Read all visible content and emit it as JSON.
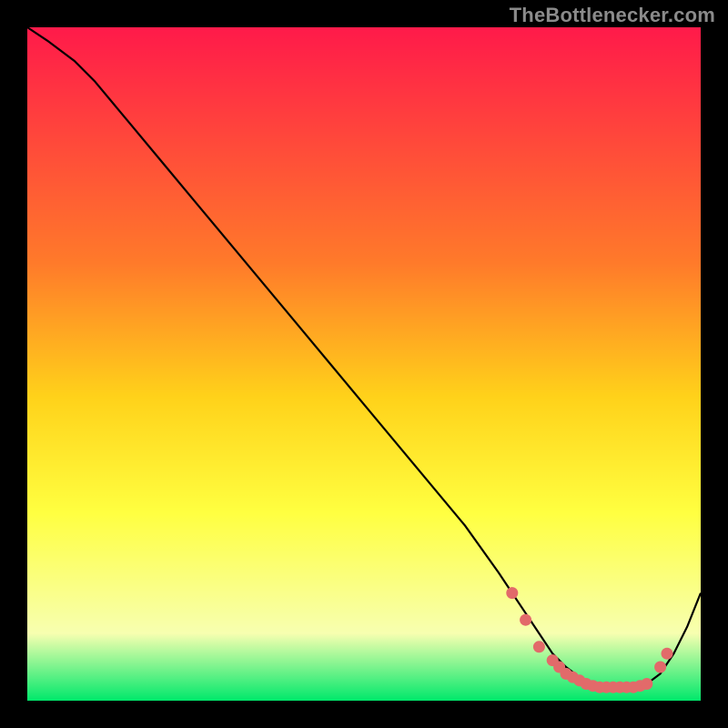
{
  "attribution": "TheBottlenecker.com",
  "colors": {
    "bg_black": "#000000",
    "grad_top": "#ff1a4a",
    "grad_mid1": "#ff7a2a",
    "grad_mid2": "#ffd21a",
    "grad_mid3": "#ffff40",
    "grad_low": "#f7ffb0",
    "grad_bottom": "#00e86b",
    "curve": "#000000",
    "dots": "#e26a6a"
  },
  "chart_data": {
    "type": "line",
    "title": "",
    "xlabel": "",
    "ylabel": "",
    "xlim": [
      0,
      100
    ],
    "ylim": [
      0,
      100
    ],
    "x": [
      0,
      3,
      7,
      10,
      15,
      20,
      25,
      30,
      35,
      40,
      45,
      50,
      55,
      60,
      65,
      70,
      72,
      74,
      76,
      78,
      80,
      82,
      84,
      86,
      88,
      90,
      92,
      94,
      96,
      98,
      100
    ],
    "values": [
      100,
      98,
      95,
      92,
      86,
      80,
      74,
      68,
      62,
      56,
      50,
      44,
      38,
      32,
      26,
      19,
      16,
      13,
      10,
      7,
      5,
      3.5,
      2.5,
      2,
      2,
      2,
      2.5,
      4,
      7,
      11,
      16
    ],
    "highlight_points": {
      "x": [
        72,
        74,
        76,
        78,
        79,
        80,
        81,
        82,
        83,
        84,
        85,
        86,
        87,
        88,
        89,
        90,
        91,
        92,
        94,
        95
      ],
      "y": [
        16,
        12,
        8,
        6,
        5,
        4,
        3.5,
        3,
        2.5,
        2.2,
        2,
        2,
        2,
        2,
        2,
        2,
        2.2,
        2.5,
        5,
        7
      ]
    }
  }
}
